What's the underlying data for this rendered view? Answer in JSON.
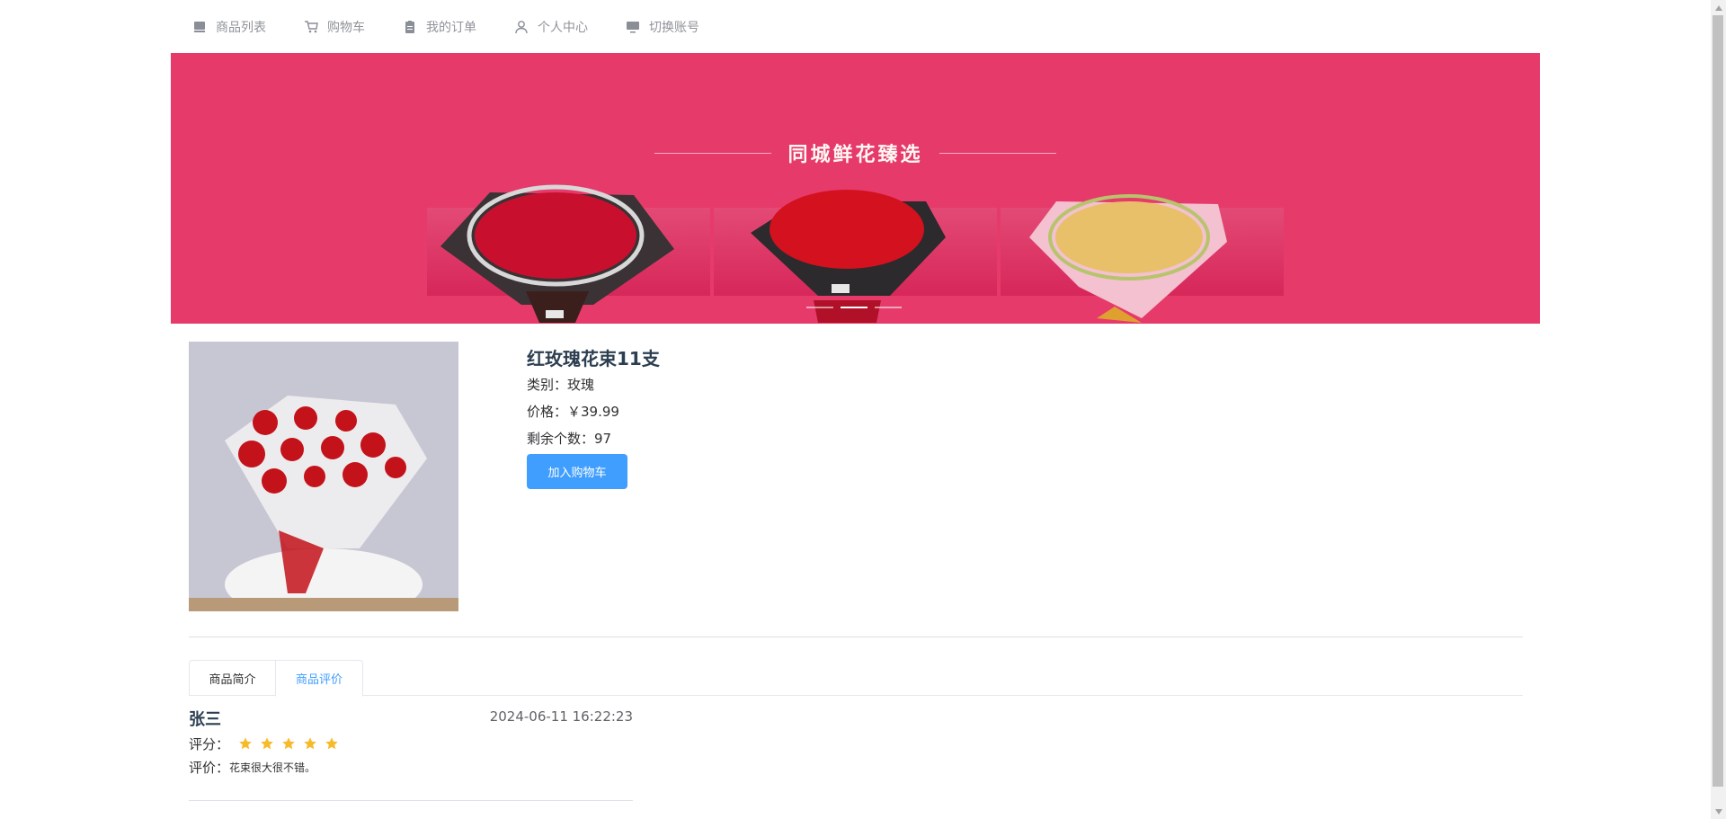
{
  "nav": {
    "items": [
      {
        "label": "商品列表",
        "icon": "shop-icon"
      },
      {
        "label": "购物车",
        "icon": "cart-icon"
      },
      {
        "label": "我的订单",
        "icon": "order-icon"
      },
      {
        "label": "个人中心",
        "icon": "user-icon"
      },
      {
        "label": "切换账号",
        "icon": "monitor-icon"
      }
    ]
  },
  "banner": {
    "title": "同城鲜花臻选",
    "slide_count": 3,
    "active_slide": 2,
    "color": "#e63a6b"
  },
  "product": {
    "name": "红玫瑰花束11支",
    "category_label": "类别：",
    "category": "玫瑰",
    "price_label": "价格：",
    "price": "￥39.99",
    "stock_label": "剩余个数：",
    "stock": "97",
    "add_to_cart": "加入购物车"
  },
  "tabs": [
    {
      "label": "商品简介",
      "active": false
    },
    {
      "label": "商品评价",
      "active": true
    }
  ],
  "review": {
    "user": "张三",
    "date": "2024-06-11 16:22:23",
    "rating_label": "评分：",
    "rating": 5,
    "comment_label": "评价：",
    "comment": "花束很大很不错。"
  },
  "colors": {
    "primary": "#409eff",
    "star": "#f7ba2a"
  }
}
